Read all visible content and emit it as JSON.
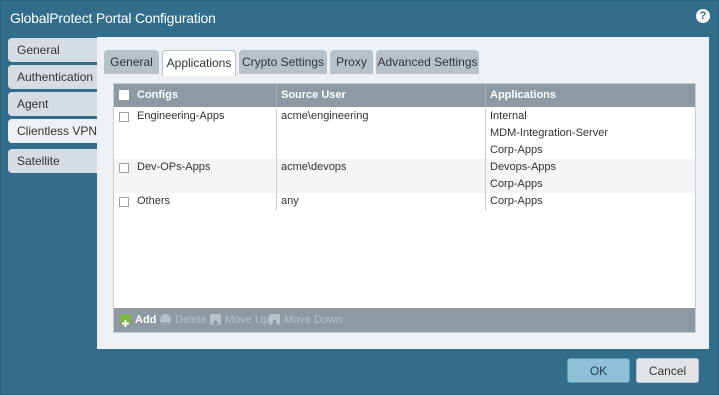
{
  "window": {
    "title": "GlobalProtect Portal Configuration",
    "help_icon": "help-icon"
  },
  "sidebar": {
    "items": [
      {
        "label": "General"
      },
      {
        "label": "Authentication"
      },
      {
        "label": "Agent"
      },
      {
        "label": "Clientless VPN"
      },
      {
        "label": "Satellite"
      }
    ]
  },
  "tabs": [
    {
      "label": "General"
    },
    {
      "label": "Applications",
      "active": true
    },
    {
      "label": "Crypto Settings"
    },
    {
      "label": "Proxy"
    },
    {
      "label": "Advanced Settings"
    }
  ],
  "table": {
    "columns": [
      "Configs",
      "Source User",
      "Applications"
    ],
    "rows": [
      {
        "config": "Engineering-Apps",
        "source_user": "acme\\engineering",
        "applications": [
          "Internal",
          "MDM-Integration-Server",
          "Corp-Apps"
        ]
      },
      {
        "config": "Dev-OPs-Apps",
        "source_user": "acme\\devops",
        "applications": [
          "Devops-Apps",
          "Corp-Apps"
        ]
      },
      {
        "config": "Others",
        "source_user": "any",
        "applications": [
          "Corp-Apps"
        ]
      }
    ]
  },
  "footer_actions": {
    "add": "Add",
    "delete": "Delete",
    "move_up": "Move Up",
    "move_down": "Move Down"
  },
  "buttons": {
    "ok": "OK",
    "cancel": "Cancel"
  },
  "colors": {
    "header_bg": "#336d8c",
    "grid_header": "#8d9aa3",
    "tab_inactive": "#b7c1c9",
    "add_icon": "#7cb342"
  }
}
